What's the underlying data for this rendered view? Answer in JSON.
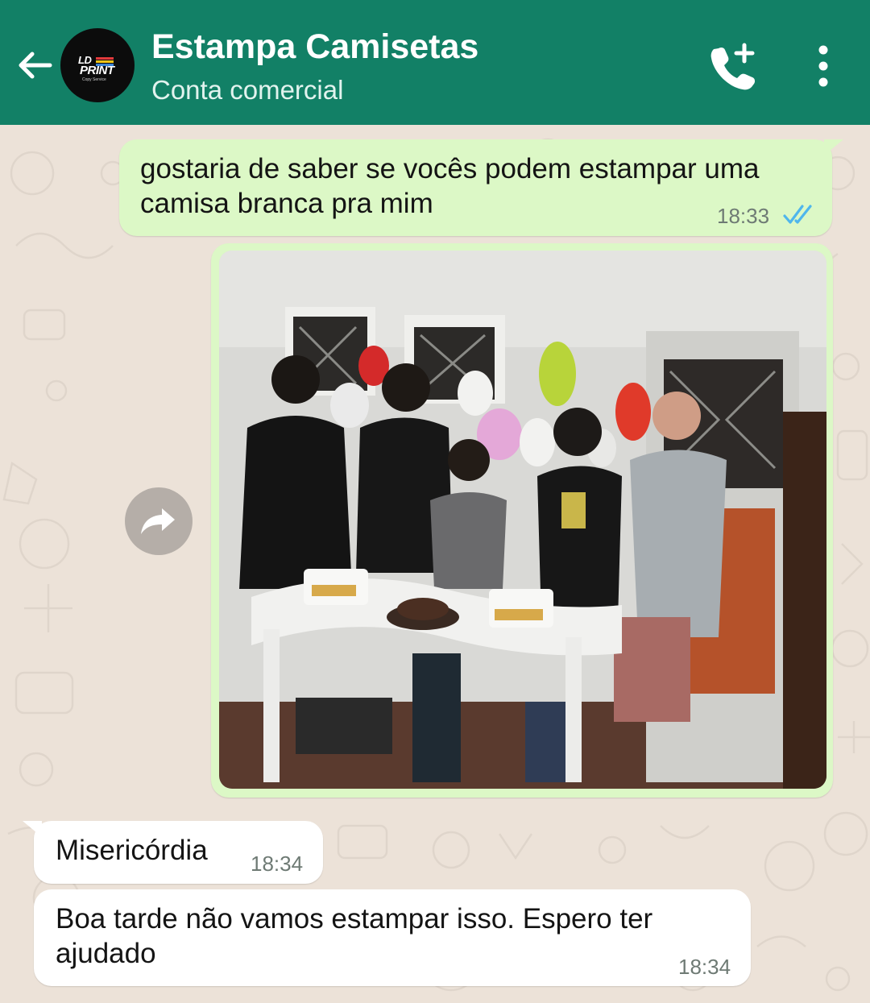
{
  "header": {
    "contact_name": "Estampa Camisetas",
    "subtitle": "Conta comercial",
    "avatar_logo_top": "LD",
    "avatar_logo_bottom": "PRINT",
    "avatar_logo_sub": "Copy Service",
    "background_color": "#128066",
    "icons": [
      "back-arrow-icon",
      "add-call-icon",
      "more-vert-icon"
    ]
  },
  "messages": [
    {
      "direction": "outgoing",
      "text": "gostaria de saber se vocês podem estampar uma camisa branca pra mim",
      "time": "18:33",
      "status": "read"
    },
    {
      "direction": "outgoing",
      "type": "image",
      "description_icon": "photo-group-party"
    },
    {
      "direction": "incoming",
      "text": "Misericórdia",
      "time": "18:34"
    },
    {
      "direction": "incoming",
      "text": "Boa tarde não vamos estampar isso. Espero ter ajudado",
      "time": "18:34"
    }
  ],
  "colors": {
    "outgoing_bubble": "#dcf8c6",
    "incoming_bubble": "#ffffff",
    "read_ticks": "#4fb6ec",
    "chat_background": "#ece2d8"
  }
}
